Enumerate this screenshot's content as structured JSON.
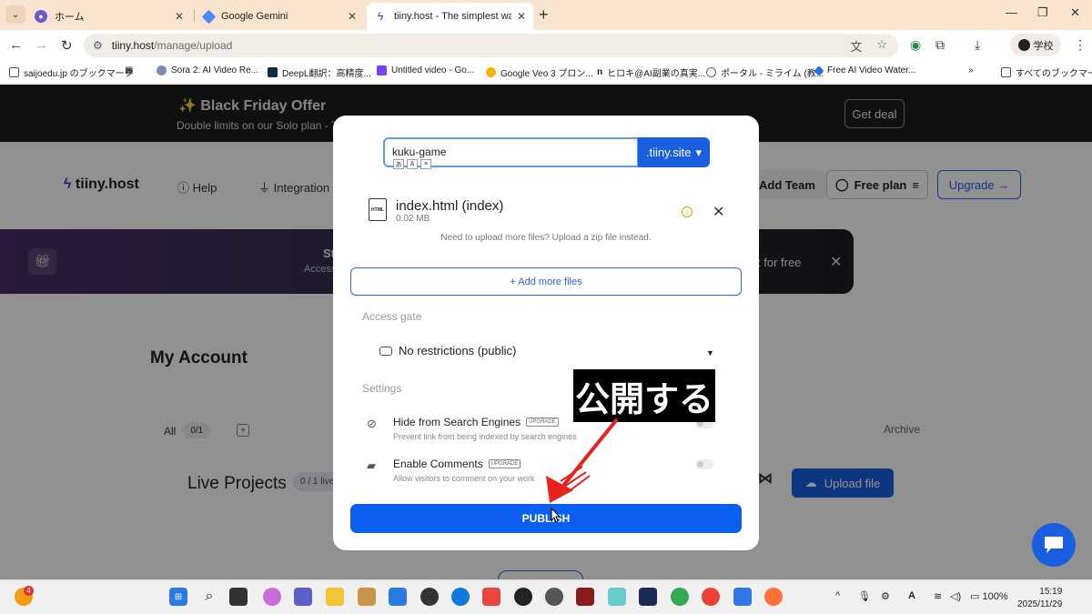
{
  "browser": {
    "tabs": [
      {
        "title": "ホーム",
        "active": false
      },
      {
        "title": "Google Gemini",
        "active": false
      },
      {
        "title": "tiiny.host - The simplest way to",
        "active": true
      }
    ],
    "url_host": "tiiny.host",
    "url_path": "/manage/upload",
    "profile_label": "学校",
    "bookmarks": [
      "saijoedu.jp のブックマーク",
      "Sora 2: AI Video Re...",
      "DeepL翻訳：高精度...",
      "Untitled video - Go...",
      "Google Veo 3 プロン...",
      "ヒロキ@AI副業の真実...",
      "ポータル - ミライム (教...",
      "Free AI Video Water...",
      "すべてのブックマーク"
    ]
  },
  "promo": {
    "title": "✨ Black Friday Offer",
    "subtitle": "Double limits on our Solo plan - Twi",
    "cta": "Get deal"
  },
  "site_nav": {
    "logo": "tiiny.host",
    "help": "Help",
    "integrations": "Integration",
    "add_team": "Add Team",
    "free_plan": "Free plan",
    "upgrade": "Upgrade →"
  },
  "banner": {
    "title": "St",
    "subtitle": "Access",
    "cta": "t for free"
  },
  "account": {
    "heading": "My Account",
    "tab_all": "All",
    "tab_all_count": "0/1",
    "archive": "Archive",
    "live_projects": "Live Projects",
    "live_count": "0 / 1 live",
    "upload_file": "Upload file"
  },
  "modal": {
    "subdomain_value": "kuku-game",
    "domain_suffix": ".tiiny.site",
    "file_name": "index.html (index)",
    "file_size": "0.02 MB",
    "file_type": "HTML",
    "zip_hint": "Need to upload more files? Upload a zip file instead.",
    "add_more": "+ Add more files",
    "access_gate_label": "Access gate",
    "access_option": "No restrictions (public)",
    "settings_label": "Settings",
    "settings": [
      {
        "title": "Hide from Search Engines",
        "badge": "UPGRADE",
        "desc": "Prevent link from being indexed by search engines"
      },
      {
        "title": "Enable Comments",
        "badge": "UPGRADE",
        "desc": "Allow visitors to comment on your work"
      }
    ],
    "publish": "PUBLISH"
  },
  "annotation": {
    "text": "公開する",
    "arrow_color": "#e8231d"
  },
  "taskbar": {
    "notification_count": "4",
    "battery": "100%",
    "time": "15:19",
    "date": "2025/11/29"
  },
  "colors": {
    "accent": "#1a5fe0",
    "publish": "#0a5ff0",
    "promo_bg": "#1d1d1d",
    "tab_strip": "#f8e4cf"
  }
}
